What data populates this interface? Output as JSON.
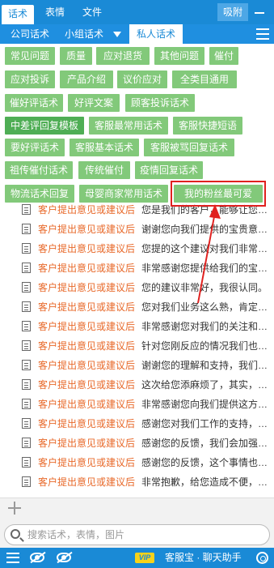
{
  "top_tabs": [
    "话术",
    "表情",
    "文件"
  ],
  "attach_label": "吸附",
  "sub_tabs": {
    "company": "公司话术",
    "group": "小组话术",
    "private": "私人话术"
  },
  "tags": [
    "常见问题",
    "质量",
    "应对退货",
    "其他问题",
    "催付",
    "应对投诉",
    "产品介绍",
    "议价应对",
    "全类目通用",
    "催好评话术",
    "好评文案",
    "顾客投诉话术",
    "中差评回复模板",
    "客服最常用话术",
    "客服快捷短语",
    "要好评话术",
    "客服基本话术",
    "客服被骂回复话术",
    "祖传催付话术",
    "传统催付",
    "疫情回复话术",
    "物流话术回复",
    "母婴商家常用话术",
    "我的粉丝最可爱"
  ],
  "active_tag": "中差评回复模板",
  "highlighted_tag": "我的粉丝最可爱",
  "list_rows": [
    {
      "category": "客户提出意见或建议后",
      "text": "您是我们的客户，能够让您…"
    },
    {
      "category": "客户提出意见或建议后",
      "text": "谢谢您向我们提供的宝贵意…"
    },
    {
      "category": "客户提出意见或建议后",
      "text": "您提的这个建议对我们非常…"
    },
    {
      "category": "客户提出意见或建议后",
      "text": "非常感谢您提供给我们的宝…"
    },
    {
      "category": "客户提出意见或建议后",
      "text": "您的建议非常好，我很认同。"
    },
    {
      "category": "客户提出意见或建议后",
      "text": "您对我们业务这么熟，肯定…"
    },
    {
      "category": "客户提出意见或建议后",
      "text": "非常感谢您对我们的关注和…"
    },
    {
      "category": "客户提出意见或建议后",
      "text": "针对您刚反应的情况我们也…"
    },
    {
      "category": "客户提出意见或建议后",
      "text": "谢谢您的理解和支持，我们…"
    },
    {
      "category": "客户提出意见或建议后",
      "text": "这次给您添麻烦了，其实，…"
    },
    {
      "category": "客户提出意见或建议后",
      "text": "非常感谢您向我们提供这方…"
    },
    {
      "category": "客户提出意见或建议后",
      "text": "感谢您对我们工作的支持，…"
    },
    {
      "category": "客户提出意见或建议后",
      "text": "感谢您的反馈，我们会加强…"
    },
    {
      "category": "客户提出意见或建议后",
      "text": "感谢您的反馈，这个事情也…"
    },
    {
      "category": "客户提出意见或建议后",
      "text": "非常抱歉，给您造成不便，…"
    }
  ],
  "search_placeholder": "搜索话术，表情，图片",
  "bottom": {
    "vip": "VIP",
    "brand": "客服宝 · 聊天助手"
  },
  "colors": {
    "primary": "#1a8ad6",
    "tag": "#82c97a",
    "tag_active": "#4fae55",
    "category_text": "#e8692a",
    "highlight": "#e0211f"
  }
}
